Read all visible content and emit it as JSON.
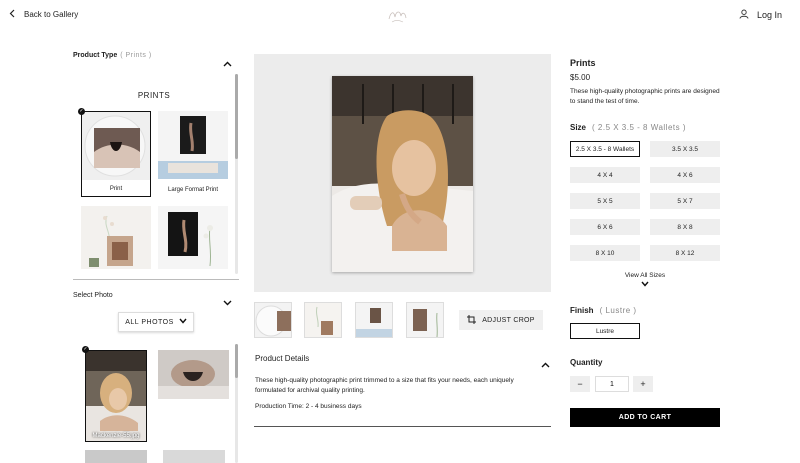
{
  "header": {
    "back_label": "Back to Gallery",
    "login_label": "Log In"
  },
  "product_type": {
    "label": "Product Type",
    "selected": "( Prints )",
    "section_title": "PRINTS",
    "cards": [
      {
        "label": "Print",
        "selected": true
      },
      {
        "label": "Large Format Print",
        "selected": false
      },
      {
        "label": "",
        "selected": false
      },
      {
        "label": "",
        "selected": false
      }
    ]
  },
  "select_photo": {
    "label": "Select Photo",
    "all_photos_label": "ALL PHOTOS",
    "photos": [
      {
        "filename": "Mackenzie-55.jpg",
        "selected": true
      },
      {
        "filename": "",
        "selected": false
      }
    ]
  },
  "actions": {
    "adjust_crop_label": "ADJUST CROP"
  },
  "product_details": {
    "title": "Product Details",
    "text": "These high-quality photographic print trimmed to a size that fits your needs, each uniquely formulated for archival quality printing.",
    "production_time": "Production Time: 2 - 4 business days"
  },
  "product": {
    "name": "Prints",
    "price": "$5.00",
    "description": "These high-quality photographic prints are designed to stand the test of time."
  },
  "size": {
    "label": "Size",
    "selected": "( 2.5 X 3.5 - 8 Wallets )",
    "options": [
      "2.5 X 3.5 - 8 Wallets",
      "3.5 X 3.5",
      "4 X 4",
      "4 X 6",
      "5 X 5",
      "5 X 7",
      "6 X 6",
      "8 X 8",
      "8 X 10",
      "8 X 12"
    ],
    "view_all_label": "View All Sizes"
  },
  "finish": {
    "label": "Finish",
    "selected": "( Lustre )",
    "options": [
      "Lustre"
    ]
  },
  "quantity": {
    "label": "Quantity",
    "value": "1",
    "minus": "−",
    "plus": "+"
  },
  "cart": {
    "label": "ADD TO CART"
  },
  "colors": {
    "accent": "#000000",
    "panel_bg": "#ececec",
    "button_bg": "#eeeeee"
  }
}
